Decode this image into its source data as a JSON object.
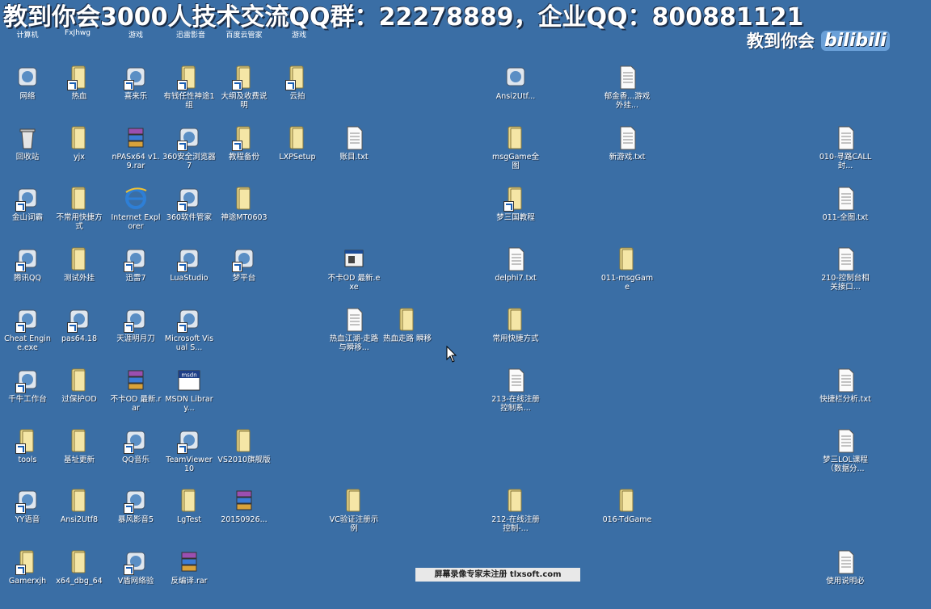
{
  "banner": {
    "text": "教到你会3000人技术交流QQ群：22278889，企业QQ：800881121"
  },
  "top_row": [
    "计算机",
    "FxJhwg",
    "游戏",
    "迅雷影音",
    "百度云管家",
    "游戏"
  ],
  "watermark": {
    "text": "教到你会",
    "logo": "bilibili"
  },
  "icons": [
    {
      "label": "网络",
      "kind": "app"
    },
    {
      "label": "热血",
      "kind": "folder-shortcut"
    },
    {
      "label": "喜来乐",
      "kind": "app-shortcut"
    },
    {
      "label": "有钱任性神途1组",
      "kind": "folder-shortcut"
    },
    {
      "label": "大纲及收费说明",
      "kind": "folder-shortcut"
    },
    {
      "label": "云拍",
      "kind": "folder-shortcut"
    },
    {
      "label": "Ansi2Utf...",
      "kind": "app"
    },
    {
      "label": "郁金香...游戏外挂...",
      "kind": "text"
    },
    {
      "label": "回收站",
      "kind": "recycle"
    },
    {
      "label": "yjx",
      "kind": "folder"
    },
    {
      "label": "nPASx64 v1.9.rar",
      "kind": "rar"
    },
    {
      "label": "360安全浏览器7",
      "kind": "app-shortcut"
    },
    {
      "label": "教程备份",
      "kind": "folder-shortcut"
    },
    {
      "label": "LXPSetup",
      "kind": "folder"
    },
    {
      "label": "账目.txt",
      "kind": "text"
    },
    {
      "label": "msgGame全图",
      "kind": "folder"
    },
    {
      "label": "新游戏.txt",
      "kind": "text"
    },
    {
      "label": "010-寻路CALL封...",
      "kind": "text"
    },
    {
      "label": "金山词霸",
      "kind": "app-shortcut"
    },
    {
      "label": "不常用快捷方式",
      "kind": "folder"
    },
    {
      "label": "Internet Explorer",
      "kind": "ie"
    },
    {
      "label": "360软件管家",
      "kind": "app-shortcut"
    },
    {
      "label": "神途MT0603",
      "kind": "folder"
    },
    {
      "label": "梦三国教程",
      "kind": "folder-shortcut"
    },
    {
      "label": "011-全图.txt",
      "kind": "text"
    },
    {
      "label": "腾讯QQ",
      "kind": "app-shortcut"
    },
    {
      "label": "测试外挂",
      "kind": "folder"
    },
    {
      "label": "迅雷7",
      "kind": "app-shortcut"
    },
    {
      "label": "LuaStudio",
      "kind": "app-shortcut"
    },
    {
      "label": "梦平台",
      "kind": "app-shortcut"
    },
    {
      "label": "不卡OD 最新.exe",
      "kind": "exe"
    },
    {
      "label": "delphi7.txt",
      "kind": "text"
    },
    {
      "label": "011-msgGame",
      "kind": "folder"
    },
    {
      "label": "210-控制台相关接口...",
      "kind": "text"
    },
    {
      "label": "Cheat Engine.exe",
      "kind": "app-shortcut"
    },
    {
      "label": "pas64.18",
      "kind": "app-shortcut"
    },
    {
      "label": "天涯明月刀",
      "kind": "app-shortcut"
    },
    {
      "label": "Microsoft Visual S...",
      "kind": "app-shortcut"
    },
    {
      "label": "热血江湖-走路与瞬移...",
      "kind": "text"
    },
    {
      "label": "热血走路 瞬移",
      "kind": "folder"
    },
    {
      "label": "常用快捷方式",
      "kind": "folder"
    },
    {
      "label": "千牛工作台",
      "kind": "app-shortcut"
    },
    {
      "label": "过保护OD",
      "kind": "folder"
    },
    {
      "label": "不卡OD 最新.rar",
      "kind": "rar"
    },
    {
      "label": "MSDN Library...",
      "kind": "msdn"
    },
    {
      "label": "213-在线注册控制系...",
      "kind": "text"
    },
    {
      "label": "快捷栏分析.txt",
      "kind": "text"
    },
    {
      "label": "tools",
      "kind": "folder-shortcut"
    },
    {
      "label": "基址更新",
      "kind": "folder"
    },
    {
      "label": "QQ音乐",
      "kind": "app-shortcut"
    },
    {
      "label": "TeamViewer 10",
      "kind": "app-shortcut"
    },
    {
      "label": "VS2010旗舰版",
      "kind": "folder"
    },
    {
      "label": "梦三LOL课程（数据分...",
      "kind": "text"
    },
    {
      "label": "YY语音",
      "kind": "app-shortcut"
    },
    {
      "label": "Ansi2Utf8",
      "kind": "folder"
    },
    {
      "label": "暴风影音5",
      "kind": "app-shortcut"
    },
    {
      "label": "LgTest",
      "kind": "folder"
    },
    {
      "label": "20150926...",
      "kind": "rar"
    },
    {
      "label": "VC验证注册示例",
      "kind": "folder"
    },
    {
      "label": "212-在线注册控制-...",
      "kind": "folder"
    },
    {
      "label": "016-TdGame",
      "kind": "folder"
    },
    {
      "label": "Gamerxjh",
      "kind": "folder-shortcut"
    },
    {
      "label": "x64_dbg_64",
      "kind": "folder"
    },
    {
      "label": "V盾网络验",
      "kind": "app-shortcut"
    },
    {
      "label": "反编译.rar",
      "kind": "rar"
    },
    {
      "label": "使用说明必",
      "kind": "text"
    }
  ],
  "footer": {
    "text": "屏幕录像专家未注册 tlxsoft.com"
  },
  "colors": {
    "desktop": "#3a6ea5",
    "folder": "#e8d48a",
    "text_file": "#f4f4f4"
  }
}
